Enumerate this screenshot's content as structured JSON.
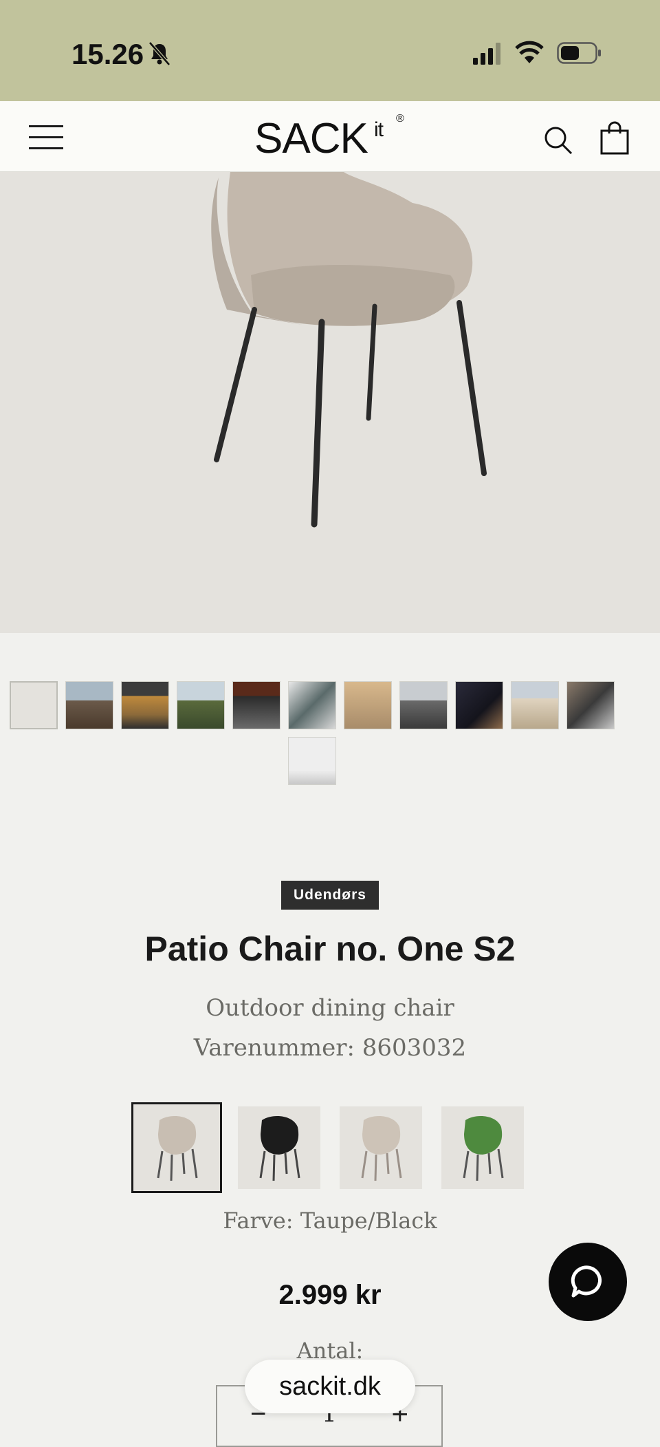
{
  "status_bar": {
    "time": "15.26",
    "icons": [
      "bell-slash-icon",
      "cellular-signal-icon",
      "wifi-icon",
      "battery-icon"
    ]
  },
  "header": {
    "logo_main": "SACK",
    "logo_sup": "it",
    "logo_reg": "®",
    "icons": [
      "hamburger-menu-icon",
      "search-icon",
      "shopping-bag-icon"
    ]
  },
  "gallery": {
    "thumbnail_count": 12,
    "active_index": 0
  },
  "product": {
    "badge": "Udendørs",
    "title": "Patio Chair no. One S2",
    "subtitle": "Outdoor dining chair",
    "sku": "Varenummer: 8603032",
    "color_label": "Farve: Taupe/Black",
    "price": "2.999 kr",
    "quantity_label": "Antal:",
    "quantity": "1"
  },
  "swatches": [
    {
      "name": "taupe-black",
      "color": "#c8beb2",
      "selected": true
    },
    {
      "name": "black",
      "color": "#1c1c1c",
      "selected": false
    },
    {
      "name": "taupe-light",
      "color": "#cdc3b7",
      "selected": false
    },
    {
      "name": "green",
      "color": "#4e8a3e",
      "selected": false
    }
  ],
  "browser": {
    "url": "sackit.dk"
  },
  "colors": {
    "status_bar_bg": "#c1c39c",
    "page_bg": "#f1f1ee",
    "hero_bg": "#e4e2dd",
    "badge_bg": "#2e2e2e"
  }
}
